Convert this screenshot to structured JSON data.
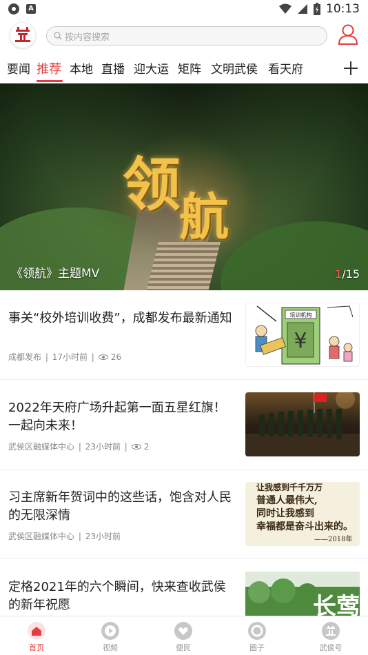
{
  "status_bar": {
    "time": "10:13"
  },
  "header": {
    "logo_icon": "app-logo-icon",
    "search_placeholder": "按内容搜索",
    "user_icon": "user-profile-icon"
  },
  "tabs": [
    {
      "label": "要闻",
      "active": false
    },
    {
      "label": "推荐",
      "active": true
    },
    {
      "label": "本地",
      "active": false
    },
    {
      "label": "直播",
      "active": false
    },
    {
      "label": "迎大运",
      "active": false
    },
    {
      "label": "矩阵",
      "active": false
    },
    {
      "label": "文明武侯",
      "active": false
    },
    {
      "label": "看天府",
      "active": false
    }
  ],
  "banner": {
    "graphic_text_1": "领",
    "graphic_text_2": "航",
    "caption": "《领航》主题MV",
    "pager_current": "1",
    "pager_total": "/15"
  },
  "news": [
    {
      "title": "事关“校外培训收费”，成都发布最新通知",
      "source": "成都发布",
      "time": "17小时前",
      "views": "26",
      "thumb_text": "培训机构"
    },
    {
      "title": "2022年天府广场升起第一面五星红旗！一起向未来！",
      "source": "武侯区融媒体中心",
      "time": "23小时前",
      "views": "2"
    },
    {
      "title": "习主席新年贺词中的这些话，饱含对人民的无限深情",
      "source": "武侯区融媒体中心",
      "time": "23小时前",
      "thumb_lines": [
        "让我感到千千万万",
        "普通人最伟大,",
        "同时让我感到",
        "幸福都是奋斗出来的。",
        "——2018年"
      ]
    },
    {
      "title": "定格2021年的六个瞬间，快来查收武侯的新年祝愿",
      "thumb_text": "长莺"
    }
  ],
  "bottom_nav": [
    {
      "label": "首页",
      "icon": "home-icon",
      "active": true
    },
    {
      "label": "视频",
      "icon": "video-play-icon",
      "active": false
    },
    {
      "label": "便民",
      "icon": "heart-icon",
      "active": false
    },
    {
      "label": "圈子",
      "icon": "circle-icon",
      "active": false
    },
    {
      "label": "武侯号",
      "icon": "wuhou-logo-icon",
      "active": false
    }
  ],
  "colors": {
    "accent": "#e63c3c",
    "text": "#222222",
    "meta": "#888888"
  }
}
